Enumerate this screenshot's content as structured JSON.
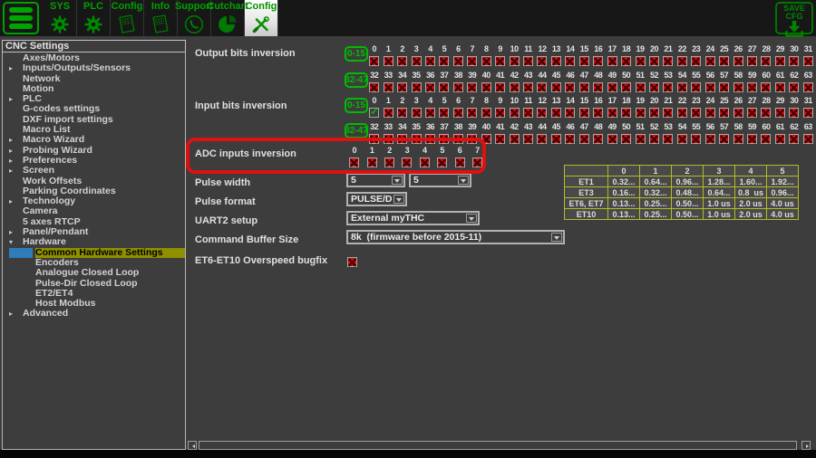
{
  "toolbar": {
    "tabs": [
      {
        "id": "menu",
        "label": "",
        "icon": "hamburger-icon"
      },
      {
        "id": "sys",
        "label": "SYS",
        "icon": "gear-icon"
      },
      {
        "id": "plc",
        "label": "PLC",
        "icon": "gear-icon"
      },
      {
        "id": "config-file",
        "label": "Config",
        "icon": "document-icon"
      },
      {
        "id": "info",
        "label": "Info",
        "icon": "document-icon"
      },
      {
        "id": "support",
        "label": "Support",
        "icon": "phone-icon"
      },
      {
        "id": "cutchart",
        "label": "Cutchart",
        "icon": "pie-chart-icon"
      },
      {
        "id": "config",
        "label": "Config",
        "icon": "tools-icon",
        "active": true
      }
    ],
    "save_button": {
      "label_line1": "SAVE",
      "label_line2": "CFG"
    }
  },
  "sidebar": {
    "title": "CNC Settings",
    "items": [
      {
        "label": "Axes/Motors",
        "indent": 1
      },
      {
        "label": "Inputs/Outputs/Sensors",
        "indent": 1,
        "arrow": "right"
      },
      {
        "label": "Network",
        "indent": 1
      },
      {
        "label": "Motion",
        "indent": 1
      },
      {
        "label": "PLC",
        "indent": 1,
        "arrow": "right"
      },
      {
        "label": "G-codes settings",
        "indent": 1
      },
      {
        "label": "DXF import settings",
        "indent": 1
      },
      {
        "label": "Macro List",
        "indent": 1
      },
      {
        "label": "Macro Wizard",
        "indent": 1,
        "arrow": "right"
      },
      {
        "label": "Probing Wizard",
        "indent": 1,
        "arrow": "right"
      },
      {
        "label": "Preferences",
        "indent": 1,
        "arrow": "right"
      },
      {
        "label": "Screen",
        "indent": 1,
        "arrow": "right"
      },
      {
        "label": "Work Offsets",
        "indent": 1
      },
      {
        "label": "Parking Coordinates",
        "indent": 1
      },
      {
        "label": "Technology",
        "indent": 1,
        "arrow": "right"
      },
      {
        "label": "Camera",
        "indent": 1
      },
      {
        "label": "5 axes RTCP",
        "indent": 1
      },
      {
        "label": "Panel/Pendant",
        "indent": 1,
        "arrow": "right"
      },
      {
        "label": "Hardware",
        "indent": 1,
        "arrow": "down"
      },
      {
        "label": "Common Hardware Settings",
        "indent": 2,
        "selected": true
      },
      {
        "label": "Encoders",
        "indent": 2
      },
      {
        "label": "Analogue Closed Loop",
        "indent": 2
      },
      {
        "label": "Pulse-Dir Closed Loop",
        "indent": 2
      },
      {
        "label": "ET2/ET4",
        "indent": 2
      },
      {
        "label": "Host Modbus",
        "indent": 2
      },
      {
        "label": "Advanced",
        "indent": 1,
        "arrow": "right"
      }
    ]
  },
  "main": {
    "output_bits": {
      "label": "Output bits inversion",
      "rows": [
        {
          "range_button": "0-15",
          "start": 0,
          "count": 32
        },
        {
          "range_button": "32-47",
          "start": 32,
          "count": 32
        }
      ]
    },
    "input_bits": {
      "label": "Input bits inversion",
      "rows": [
        {
          "range_button": "0-15",
          "start": 0,
          "count": 32,
          "check_indices": [
            0
          ]
        },
        {
          "range_button": "32-47",
          "start": 32,
          "count": 32
        }
      ]
    },
    "adc": {
      "label": "ADC inputs inversion",
      "start": 0,
      "count": 8
    },
    "fields": {
      "pulse_width": {
        "label": "Pulse width",
        "value1": "5",
        "value2": "5"
      },
      "pulse_format": {
        "label": "Pulse format",
        "value": "PULSE/DIR"
      },
      "uart2": {
        "label": "UART2 setup",
        "value": "External myTHC"
      },
      "buffer": {
        "label": "Command Buffer Size",
        "value": "8k  (firmware before 2015-11)"
      },
      "overspeed": {
        "label": "ET6-ET10 Overspeed bugfix",
        "checked": true
      }
    },
    "et_table": {
      "col_headers": [
        "",
        "0",
        "1",
        "2",
        "3",
        "4",
        "5"
      ],
      "rows": [
        {
          "name": "ET1",
          "cells": [
            "0.32...",
            "0.64...",
            "0.96...",
            "1.28...",
            "1.60...",
            "1.92..."
          ]
        },
        {
          "name": "ET3",
          "cells": [
            "0.16...",
            "0.32...",
            "0.48...",
            "0.64...",
            "0.8  us",
            "0.96..."
          ]
        },
        {
          "name": "ET6, ET7",
          "cells": [
            "0.13...",
            "0.25...",
            "0.50...",
            "1.0 us",
            "2.0 us",
            "4.0 us"
          ]
        },
        {
          "name": "ET10",
          "cells": [
            "0.13...",
            "0.25...",
            "0.50...",
            "1.0 us",
            "2.0 us",
            "4.0 us"
          ]
        }
      ]
    },
    "colors": {
      "accent_green": "#00a300",
      "selection_olive": "#8f8f00",
      "selection_blue": "#2e7cb8",
      "checkbox_red": "#c41414",
      "table_border_yellow": "#b9b923",
      "annotation_red": "#dd1111"
    }
  }
}
